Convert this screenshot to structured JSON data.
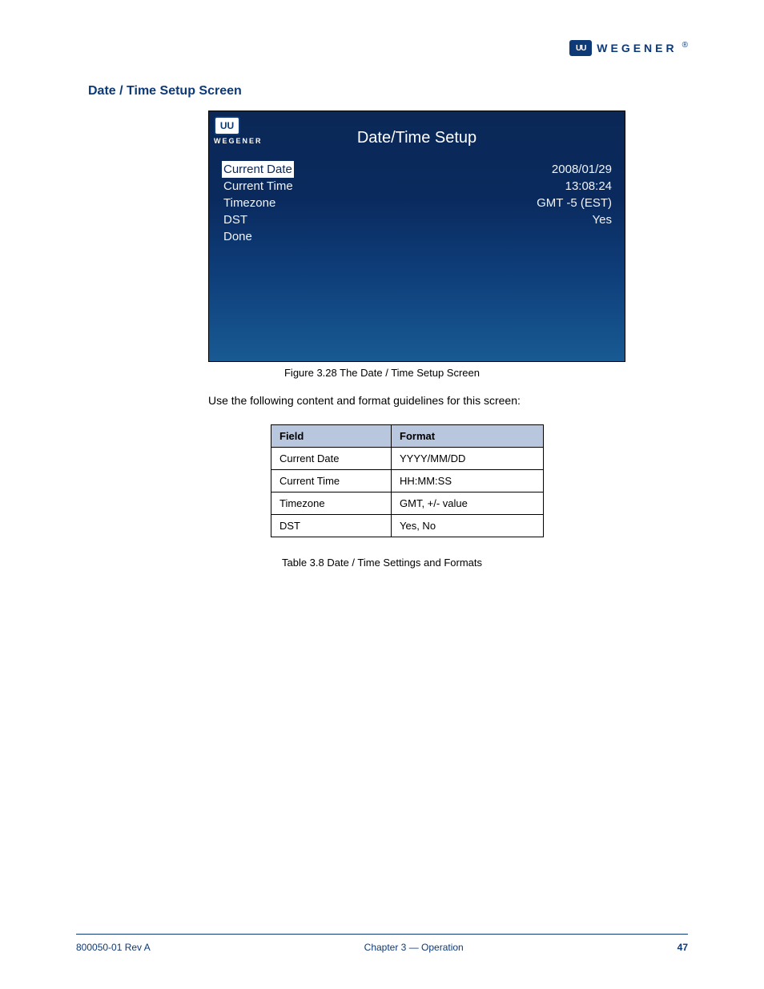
{
  "header": {
    "logo_box": "UU",
    "logo_text": "WEGENER",
    "reg": "®"
  },
  "section_heading": "Date / Time Setup  Screen",
  "screenshot": {
    "logo_box": "UU",
    "logo_text": "WEGENER",
    "title": "Date/Time Setup",
    "rows": [
      {
        "label": "Current Date",
        "value": "2008/01/29",
        "selected": true
      },
      {
        "label": "Current Time",
        "value": "13:08:24",
        "selected": false
      },
      {
        "label": "Timezone",
        "value": "GMT -5 (EST)",
        "selected": false
      },
      {
        "label": "DST",
        "value": "Yes",
        "selected": false
      },
      {
        "label": "Done",
        "value": "",
        "selected": false
      }
    ]
  },
  "fig_caption": "Figure 3.28   The Date / Time Setup Screen",
  "instruction": "Use the following content and format guidelines for this screen:",
  "table": {
    "headers": [
      "Field",
      "Format"
    ],
    "rows": [
      [
        "Current Date",
        "YYYY/MM/DD"
      ],
      [
        "Current Time",
        "HH:MM:SS"
      ],
      [
        "Timezone",
        "GMT, +/- value"
      ],
      [
        "DST",
        "Yes, No"
      ]
    ]
  },
  "table_caption": "Table 3.8   Date / Time Settings and Formats",
  "footer": {
    "left": "800050-01 Rev A",
    "center": "Chapter 3 — Operation",
    "right": "47"
  }
}
